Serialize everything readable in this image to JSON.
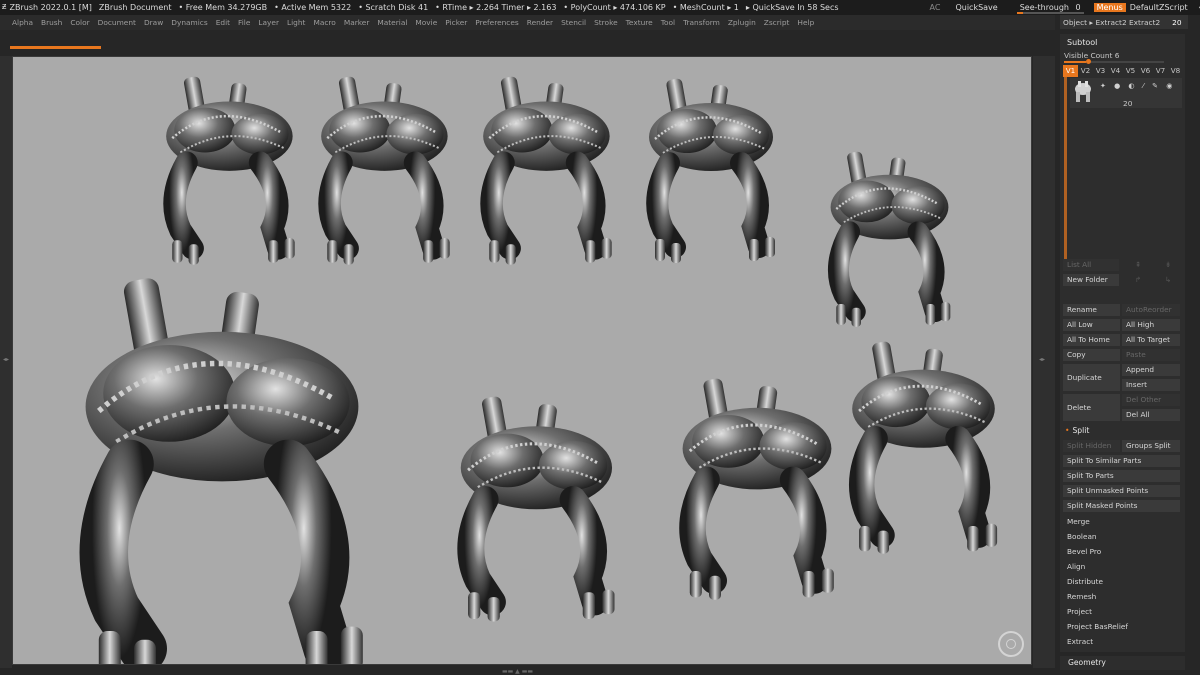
{
  "titlebar": {
    "app": "ZBrush 2022.0.1 [M]",
    "document": "ZBrush Document",
    "free_mem": "• Free Mem 34.279GB",
    "active_mem": "• Active Mem 5322",
    "scratch": "• Scratch Disk 41",
    "rtime": "• RTime ▸ 2.264 Timer ▸ 2.163",
    "polycount": "• PolyCount ▸ 474.106 KP",
    "meshcount": "• MeshCount ▸ 1",
    "quicksave_in": "▸ QuickSave In 58 Secs",
    "ac": "AC",
    "quicksave": "QuickSave",
    "see_through_label": "See-through",
    "see_through_value": "0",
    "menus": "Menus",
    "script": "DefaultZScript",
    "controls": "↞ ▯ ▭ ▢ ✕"
  },
  "menubar": [
    "Alpha",
    "Brush",
    "Color",
    "Document",
    "Draw",
    "Dynamics",
    "Edit",
    "File",
    "Layer",
    "Light",
    "Macro",
    "Marker",
    "Material",
    "Movie",
    "Picker",
    "Preferences",
    "Render",
    "Stencil",
    "Stroke",
    "Texture",
    "Tool",
    "Transform",
    "Zplugin",
    "Zscript",
    "Help"
  ],
  "right_panel": {
    "top_row": "Object ▸ Extract2 Extract2",
    "top_count": "20",
    "subtool_title": "Subtool",
    "visible_count": "Visible Count 6",
    "visible_fraction": 0.22,
    "version_tabs": [
      "V1",
      "V2",
      "V3",
      "V4",
      "V5",
      "V6",
      "V7",
      "V8"
    ],
    "active_tab": "V1",
    "subtool_icons": "✦ ● ◐ ⁄ ✎ ◉",
    "subtool_poly": "20",
    "list_all": "List All",
    "new_folder": "New Folder",
    "rename": "Rename",
    "auto_reorder": "AutoReorder",
    "all_low": "All Low",
    "all_high": "All High",
    "all_to_home": "All To Home",
    "all_to_target": "All To Target",
    "copy": "Copy",
    "paste": "Paste",
    "duplicate": "Duplicate",
    "append": "Append",
    "insert": "Insert",
    "delete": "Delete",
    "del_other": "Del Other",
    "del_all": "Del All",
    "split_title": "Split",
    "split_hidden": "Split Hidden",
    "groups_split": "Groups Split",
    "split_similar": "Split To Similar Parts",
    "split_parts": "Split To Parts",
    "split_unmasked": "Split Unmasked Points",
    "split_masked": "Split Masked Points",
    "merge": "Merge",
    "boolean": "Boolean",
    "bevel_pro": "Bevel Pro",
    "align": "Align",
    "distribute": "Distribute",
    "remesh": "Remesh",
    "project": "Project",
    "project_basrelief": "Project BasRelief",
    "extract": "Extract",
    "geometry": "Geometry"
  },
  "colors": {
    "accent": "#e8771e",
    "canvas": "#aaaaaa",
    "panel": "#262626"
  }
}
